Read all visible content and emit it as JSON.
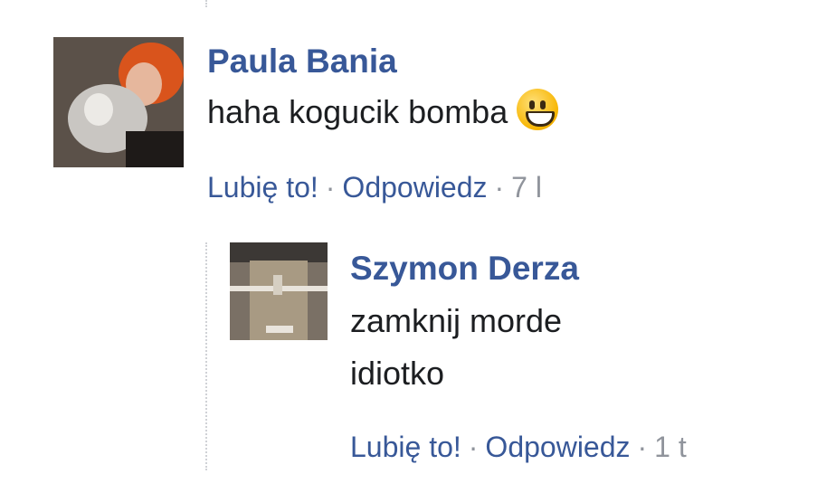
{
  "comments": [
    {
      "author": "Paula Bania",
      "text": "haha kogucik bomba",
      "emoji": "grinning-face",
      "like_label": "Lubię to!",
      "reply_label": "Odpowiedz",
      "separator": "·",
      "time": "7 l"
    },
    {
      "author": "Szymon Derza",
      "text": "zamknij morde idiotko",
      "like_label": "Lubię to!",
      "reply_label": "Odpowiedz",
      "separator": "·",
      "time": "1 t"
    }
  ],
  "colors": {
    "link": "#385898",
    "text": "#1c1e21",
    "meta": "#90949c",
    "thread_line": "#d0d2d6"
  }
}
